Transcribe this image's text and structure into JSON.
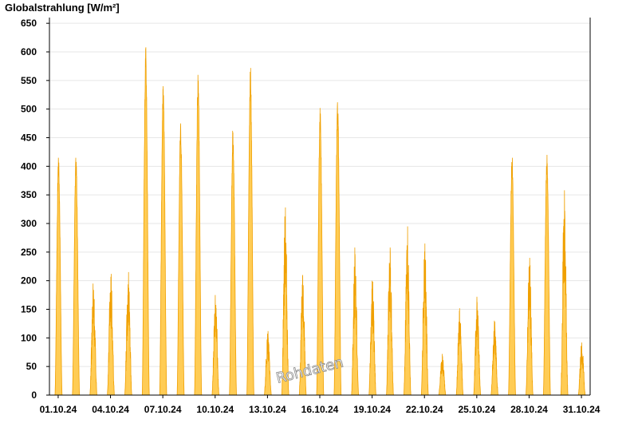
{
  "chart_data": {
    "type": "area",
    "ylabel": "Globalstrahlung [W/m²]",
    "ylim": [
      0,
      660
    ],
    "yticks": [
      0,
      50,
      100,
      150,
      200,
      250,
      300,
      350,
      400,
      450,
      500,
      550,
      600,
      650
    ],
    "xlim": [
      "2024-10-01T00:00",
      "2024-10-31T24:00"
    ],
    "xticks": [
      "01.10.24",
      "04.10.24",
      "07.10.24",
      "10.10.24",
      "13.10.24",
      "16.10.24",
      "19.10.24",
      "22.10.24",
      "25.10.24",
      "28.10.24",
      "31.10.24"
    ],
    "grid": true,
    "watermark": "Rohdaten",
    "colors": {
      "fill": "#ffcc55",
      "stroke": "#f0a000",
      "grid": "#e6e6e6",
      "axis": "#000000"
    },
    "series": [
      {
        "daily_peaks": [
          {
            "date": "2024-10-01",
            "peak": 415
          },
          {
            "date": "2024-10-02",
            "peak": 415
          },
          {
            "date": "2024-10-03",
            "peak": 195
          },
          {
            "date": "2024-10-04",
            "peak": 212
          },
          {
            "date": "2024-10-05",
            "peak": 215
          },
          {
            "date": "2024-10-06",
            "peak": 608
          },
          {
            "date": "2024-10-07",
            "peak": 540
          },
          {
            "date": "2024-10-08",
            "peak": 475
          },
          {
            "date": "2024-10-09",
            "peak": 560
          },
          {
            "date": "2024-10-10",
            "peak": 175
          },
          {
            "date": "2024-10-11",
            "peak": 462
          },
          {
            "date": "2024-10-12",
            "peak": 572
          },
          {
            "date": "2024-10-13",
            "peak": 112
          },
          {
            "date": "2024-10-14",
            "peak": 328
          },
          {
            "date": "2024-10-15",
            "peak": 210
          },
          {
            "date": "2024-10-16",
            "peak": 502
          },
          {
            "date": "2024-10-17",
            "peak": 512
          },
          {
            "date": "2024-10-18",
            "peak": 258
          },
          {
            "date": "2024-10-19",
            "peak": 200
          },
          {
            "date": "2024-10-20",
            "peak": 258
          },
          {
            "date": "2024-10-21",
            "peak": 295
          },
          {
            "date": "2024-10-22",
            "peak": 265
          },
          {
            "date": "2024-10-23",
            "peak": 72
          },
          {
            "date": "2024-10-24",
            "peak": 152
          },
          {
            "date": "2024-10-25",
            "peak": 172
          },
          {
            "date": "2024-10-26",
            "peak": 130
          },
          {
            "date": "2024-10-27",
            "peak": 415
          },
          {
            "date": "2024-10-28",
            "peak": 240
          },
          {
            "date": "2024-10-29",
            "peak": 420
          },
          {
            "date": "2024-10-30",
            "peak": 358
          },
          {
            "date": "2024-10-31",
            "peak": 92
          }
        ]
      }
    ]
  }
}
